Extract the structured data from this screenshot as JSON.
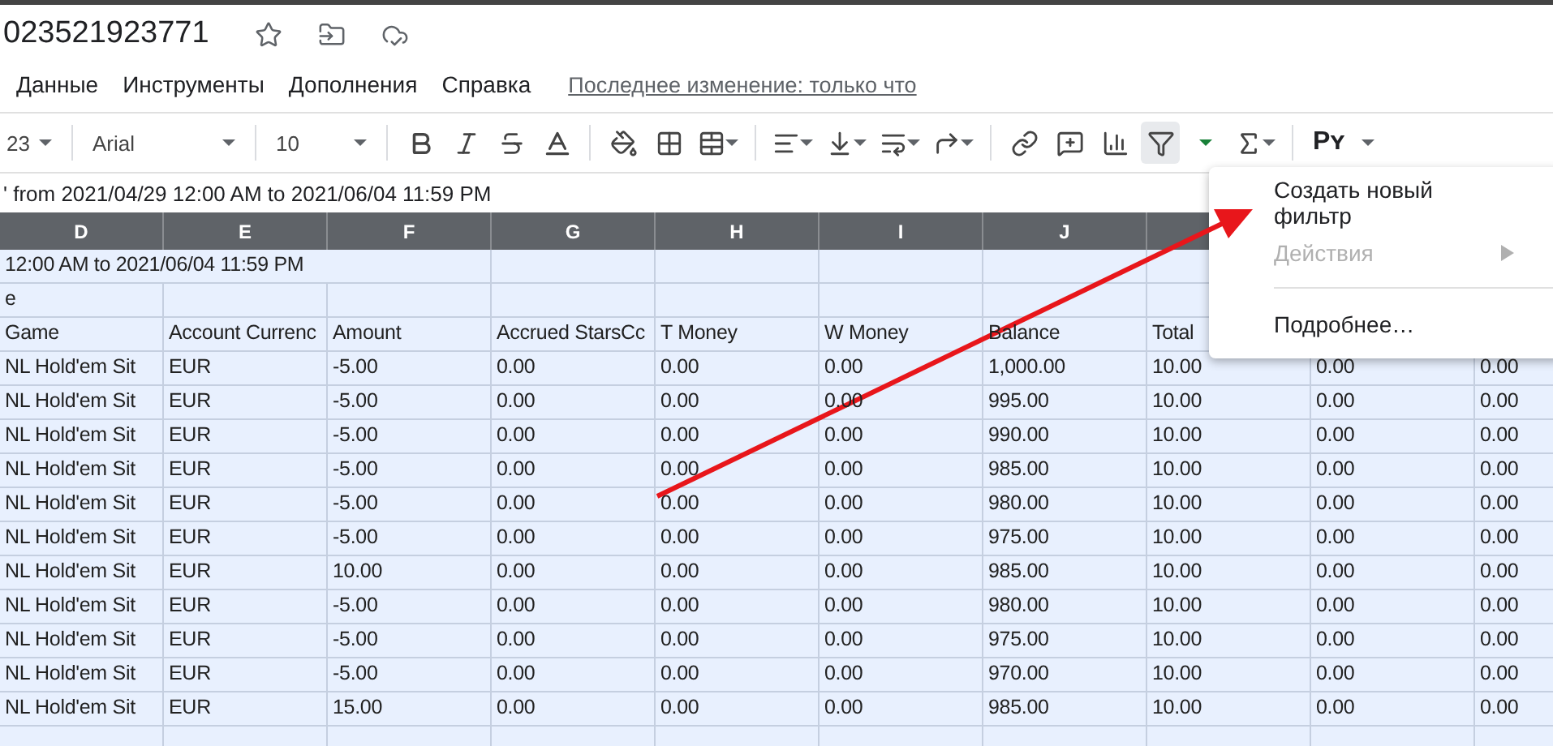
{
  "document": {
    "title": "023521923771"
  },
  "menu_bar": {
    "items": [
      "Данные",
      "Инструменты",
      "Дополнения",
      "Справка"
    ],
    "last_edit": "Последнее изменение: только что"
  },
  "toolbar": {
    "number_format": "23",
    "font": "Arial",
    "font_size": "10",
    "filter_active": true,
    "addon": "Pʏ"
  },
  "formula_bar": {
    "value": "' from 2021/04/29 12:00 AM to 2021/06/04 11:59 PM"
  },
  "sheet": {
    "columns": [
      "D",
      "E",
      "F",
      "G",
      "H",
      "I",
      "J"
    ],
    "rows": [
      {
        "kind": "overflow",
        "cells": [
          "12:00 AM to 2021/06/04 11:59 PM"
        ]
      },
      {
        "kind": "overflow",
        "cells": [
          "e"
        ]
      },
      {
        "kind": "data",
        "cells": [
          "Game",
          "Account Currenc",
          "Amount",
          "Accrued StarsCc",
          "T Money",
          "W Money",
          "Balance",
          "Total"
        ]
      },
      {
        "kind": "data",
        "cells": [
          "NL Hold'em Sit",
          "EUR",
          "-5.00",
          "0.00",
          "0.00",
          "0.00",
          "1,000.00",
          "10.00",
          "0.00",
          "0.00"
        ]
      },
      {
        "kind": "data",
        "cells": [
          "NL Hold'em Sit",
          "EUR",
          "-5.00",
          "0.00",
          "0.00",
          "0.00",
          "995.00",
          "10.00",
          "0.00",
          "0.00"
        ]
      },
      {
        "kind": "data",
        "cells": [
          "NL Hold'em Sit",
          "EUR",
          "-5.00",
          "0.00",
          "0.00",
          "0.00",
          "990.00",
          "10.00",
          "0.00",
          "0.00"
        ]
      },
      {
        "kind": "data",
        "cells": [
          "NL Hold'em Sit",
          "EUR",
          "-5.00",
          "0.00",
          "0.00",
          "0.00",
          "985.00",
          "10.00",
          "0.00",
          "0.00"
        ]
      },
      {
        "kind": "data",
        "cells": [
          "NL Hold'em Sit",
          "EUR",
          "-5.00",
          "0.00",
          "0.00",
          "0.00",
          "980.00",
          "10.00",
          "0.00",
          "0.00"
        ]
      },
      {
        "kind": "data",
        "cells": [
          "NL Hold'em Sit",
          "EUR",
          "-5.00",
          "0.00",
          "0.00",
          "0.00",
          "975.00",
          "10.00",
          "0.00",
          "0.00"
        ]
      },
      {
        "kind": "data",
        "cells": [
          "NL Hold'em Sit",
          "EUR",
          "10.00",
          "0.00",
          "0.00",
          "0.00",
          "985.00",
          "10.00",
          "0.00",
          "0.00"
        ]
      },
      {
        "kind": "data",
        "cells": [
          "NL Hold'em Sit",
          "EUR",
          "-5.00",
          "0.00",
          "0.00",
          "0.00",
          "980.00",
          "10.00",
          "0.00",
          "0.00"
        ]
      },
      {
        "kind": "data",
        "cells": [
          "NL Hold'em Sit",
          "EUR",
          "-5.00",
          "0.00",
          "0.00",
          "0.00",
          "975.00",
          "10.00",
          "0.00",
          "0.00"
        ]
      },
      {
        "kind": "data",
        "cells": [
          "NL Hold'em Sit",
          "EUR",
          "-5.00",
          "0.00",
          "0.00",
          "0.00",
          "970.00",
          "10.00",
          "0.00",
          "0.00"
        ]
      },
      {
        "kind": "data",
        "cells": [
          "NL Hold'em Sit",
          "EUR",
          "15.00",
          "0.00",
          "0.00",
          "0.00",
          "985.00",
          "10.00",
          "0.00",
          "0.00"
        ]
      }
    ]
  },
  "filter_menu": {
    "items": [
      {
        "kind": "item",
        "label": "Создать новый фильтр",
        "disabled": false
      },
      {
        "kind": "submenu",
        "label": "Действия",
        "disabled": true
      },
      {
        "kind": "divider"
      },
      {
        "kind": "item",
        "label": "Подробнее…",
        "disabled": false
      }
    ]
  }
}
